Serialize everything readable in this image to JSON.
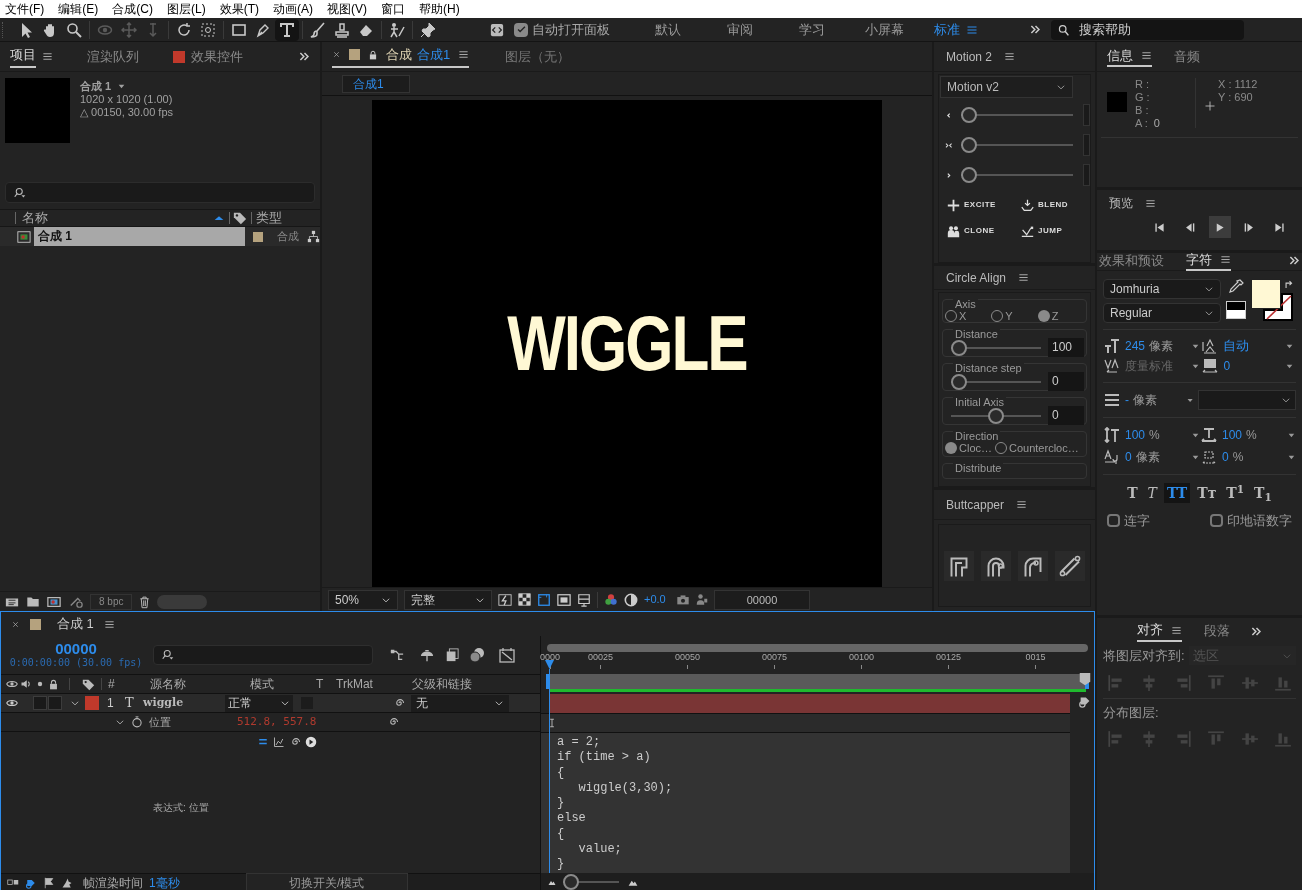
{
  "menu_bar": [
    "文件(F)",
    "编辑(E)",
    "合成(C)",
    "图层(L)",
    "效果(T)",
    "动画(A)",
    "视图(V)",
    "窗口",
    "帮助(H)"
  ],
  "toolbar": {
    "tools": [
      {
        "kind": "selection",
        "selected": false,
        "disabled": false
      },
      {
        "kind": "hand",
        "selected": false,
        "disabled": false
      },
      {
        "kind": "zoom",
        "selected": false,
        "disabled": false
      },
      {
        "kind": "orbit",
        "selected": false,
        "disabled": true
      },
      {
        "kind": "pan",
        "selected": false,
        "disabled": true
      },
      {
        "kind": "dolly",
        "selected": false,
        "disabled": true
      },
      {
        "kind": "rotate",
        "selected": false,
        "disabled": false
      },
      {
        "kind": "anchor",
        "selected": false,
        "disabled": false
      },
      {
        "kind": "rectangle",
        "selected": false,
        "disabled": false
      },
      {
        "kind": "pen",
        "selected": false,
        "disabled": false
      },
      {
        "kind": "text",
        "selected": true,
        "disabled": false
      },
      {
        "kind": "brush",
        "selected": false,
        "disabled": false
      },
      {
        "kind": "stamp",
        "selected": false,
        "disabled": false
      },
      {
        "kind": "eraser",
        "selected": false,
        "disabled": false
      },
      {
        "kind": "puppet",
        "selected": false,
        "disabled": false
      },
      {
        "kind": "pin",
        "selected": false,
        "disabled": false
      }
    ],
    "auto_open": {
      "label": "自动打开面板",
      "checked": true
    },
    "workspaces": [
      {
        "label": "默认",
        "selected": false
      },
      {
        "label": "审阅",
        "selected": false
      },
      {
        "label": "学习",
        "selected": false
      },
      {
        "label": "小屏幕",
        "selected": false
      },
      {
        "label": "标准",
        "selected": true
      }
    ],
    "help_search": {
      "placeholder": "搜索帮助"
    }
  },
  "project_panel": {
    "tabs": [
      {
        "label": "项目",
        "selected": true
      },
      {
        "label": "渲染队列",
        "selected": false
      },
      {
        "label": "效果控件",
        "selected": false
      }
    ],
    "preview": {
      "name": "合成 1",
      "size": "1020 x 1020 (1.00)",
      "duration": "△ 00150, 30.00 fps"
    },
    "columns": [
      "名称",
      "类型"
    ],
    "items": [
      {
        "name": "合成 1",
        "type": "合成",
        "selected": true,
        "color": "#b5a27e"
      }
    ],
    "bit_depth": "8 bpc"
  },
  "composition_panel": {
    "tabs": [
      {
        "label": "合成",
        "comp": "合成1",
        "selected": true,
        "color": "#b5a27e"
      },
      {
        "label": "图层（无）",
        "selected": false
      }
    ],
    "breadcrumb": "合成1",
    "canvas_text": "WIGGLE",
    "zoom": "50%",
    "resolution": "完整",
    "exposure": "+0.0",
    "timecode": "00000"
  },
  "motion_panel": {
    "title": "Motion 2",
    "preset": "Motion v2",
    "sliders": [
      {
        "kind": "ease-in",
        "level": 0
      },
      {
        "kind": "ease-both",
        "level": 0
      },
      {
        "kind": "ease-out",
        "level": 0
      }
    ],
    "buttons": [
      {
        "kind": "excite",
        "label": "EXCITE"
      },
      {
        "kind": "blend",
        "label": "BLEND"
      },
      {
        "kind": "clone",
        "label": "CLONE"
      },
      {
        "kind": "jump",
        "label": "JUMP"
      }
    ]
  },
  "circle_align": {
    "title": "Circle Align",
    "axis": {
      "label": "Axis",
      "options": [
        {
          "label": "X",
          "selected": false
        },
        {
          "label": "Y",
          "selected": false
        },
        {
          "label": "Z",
          "selected": true
        }
      ]
    },
    "fields": [
      {
        "label": "Distance",
        "level": 0,
        "value": "100"
      },
      {
        "label": "Distance step",
        "level": 0,
        "value": "0"
      },
      {
        "label": "Initial Axis",
        "level": 0.5,
        "value": "0"
      }
    ],
    "direction": {
      "label": "Direction",
      "options": [
        {
          "label": "Cloc…",
          "selected": true
        },
        {
          "label": "Countercloc…",
          "selected": false
        }
      ]
    },
    "distribute": {
      "label": "Distribute"
    }
  },
  "buttcapper": {
    "title": "Buttcapper",
    "buttons": [
      {
        "kind": "square-cap"
      },
      {
        "kind": "round-cap"
      },
      {
        "kind": "round-corner"
      },
      {
        "kind": "line-ends"
      }
    ]
  },
  "info_panel": {
    "tabs": [
      {
        "label": "信息",
        "selected": true
      },
      {
        "label": "音频",
        "selected": false
      }
    ],
    "channels": [
      {
        "label": "R :"
      },
      {
        "label": "G :"
      },
      {
        "label": "B :"
      },
      {
        "label": "A :",
        "value": "0"
      }
    ],
    "position": [
      {
        "label": "X :",
        "value": "1112"
      },
      {
        "label": "Y :",
        "value": "690"
      }
    ]
  },
  "preview_panel": {
    "title": "预览",
    "controls": [
      {
        "kind": "first",
        "selected": false
      },
      {
        "kind": "prev",
        "selected": false
      },
      {
        "kind": "play",
        "selected": true
      },
      {
        "kind": "next",
        "selected": false
      },
      {
        "kind": "last",
        "selected": false
      }
    ]
  },
  "character_panel": {
    "tabs": [
      {
        "label": "效果和预设",
        "selected": false
      },
      {
        "label": "字符",
        "selected": true
      }
    ],
    "font": "Jomhuria",
    "style": "Regular",
    "size": {
      "value": "245",
      "unit": "像素"
    },
    "leading": "自动",
    "kerning": "度量标准",
    "tracking": "0",
    "stroke_width": {
      "value": "-",
      "unit": "像素"
    },
    "vertical_scale": {
      "value": "100",
      "unit": "%"
    },
    "horizontal_scale": {
      "value": "100",
      "unit": "%"
    },
    "baseline_shift": {
      "value": "0",
      "unit": "像素"
    },
    "tsume": {
      "value": "0",
      "unit": "%"
    },
    "styles": [
      {
        "kind": "bold",
        "label": "T",
        "selected": false
      },
      {
        "kind": "italic",
        "label": "T",
        "selected": false
      },
      {
        "kind": "caps",
        "label": "TT",
        "selected": true
      },
      {
        "kind": "small-caps",
        "label": "Tᴛ",
        "selected": false
      },
      {
        "kind": "super",
        "label": "T$^{1}$",
        "selected": false
      },
      {
        "kind": "sub",
        "label": "T$_{1}$",
        "selected": false
      }
    ],
    "checkboxes": [
      {
        "label": "连字",
        "checked": false
      },
      {
        "label": "印地语数字",
        "checked": false
      }
    ]
  },
  "timeline": {
    "tab": "合成 1",
    "color": "#b5a27e",
    "timecode": "00000",
    "timecode_detail": "0:00:00:00 (30.00 fps)",
    "columns": [
      "#",
      "源名称",
      "模式",
      "T",
      "TrkMat",
      "父级和链接"
    ],
    "layers": [
      {
        "index": "1",
        "type_glyph": "T",
        "name": "wiggle",
        "mode": "正常",
        "parent": "无",
        "color": "#c0392b",
        "visible": true,
        "expanded": true
      }
    ],
    "property": {
      "name": "位置",
      "value": "512.8, 557.8",
      "expanded": true
    },
    "expression_label": "表达式: 位置",
    "ruler": [
      "0000",
      "00025",
      "00050",
      "00075",
      "00100",
      "00125",
      "0015"
    ],
    "expression": [
      "a = 2;",
      "if (time > a)",
      "{",
      "   wiggle(3,30);",
      "}",
      "else",
      "{",
      "   value;",
      "}"
    ],
    "zoom_slider": {
      "level": 0
    },
    "render_time_label": "帧渲染时间",
    "render_time": "1毫秒",
    "toggle_label": "切换开关/模式"
  },
  "align_panel": {
    "tabs": [
      {
        "label": "对齐",
        "selected": true
      },
      {
        "label": "段落",
        "selected": false
      }
    ],
    "align_to_label": "将图层对齐到:",
    "align_to": {
      "value": "选区",
      "disabled": true
    },
    "distribute_label": "分布图层:"
  }
}
